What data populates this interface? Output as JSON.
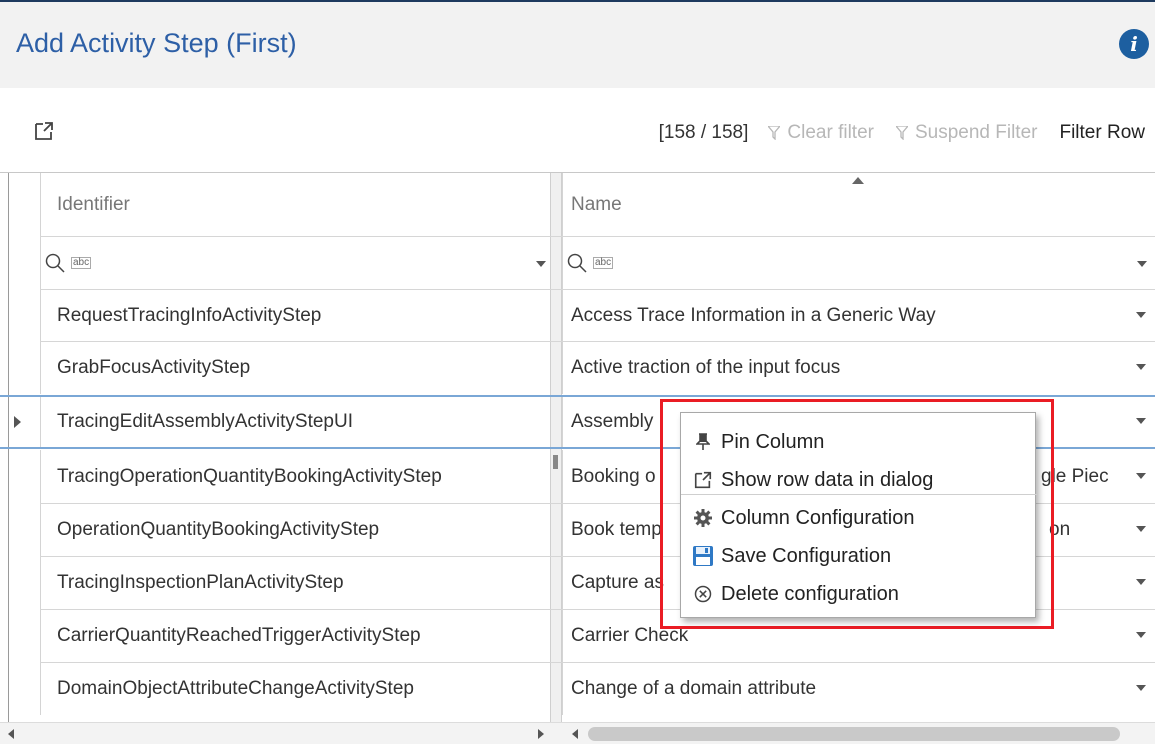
{
  "dialog": {
    "title": "Add Activity Step (First)",
    "info_icon": "info-icon"
  },
  "toolbar": {
    "counter": "[158 / 158]",
    "clear_filter": "Clear filter",
    "suspend_filter": "Suspend Filter",
    "filter_row": "Filter Row"
  },
  "columns": {
    "identifier": "Identifier",
    "name": "Name"
  },
  "rows": [
    {
      "identifier": "RequestTracingInfoActivityStep",
      "name": "Access Trace Information in a Generic Way"
    },
    {
      "identifier": "GrabFocusActivityStep",
      "name": "Active traction of the input focus"
    },
    {
      "identifier": "TracingEditAssemblyActivityStepUI",
      "name": "Assembly"
    },
    {
      "identifier": "TracingOperationQuantityBookingActivityStep",
      "name": "Booking o",
      "name_tail": "gle Piec"
    },
    {
      "identifier": "OperationQuantityBookingActivityStep",
      "name": "Book temp",
      "name_tail": "on"
    },
    {
      "identifier": "TracingInspectionPlanActivityStep",
      "name": "Capture as"
    },
    {
      "identifier": "CarrierQuantityReachedTriggerActivityStep",
      "name": "Carrier Check"
    },
    {
      "identifier": "DomainObjectAttributeChangeActivityStep",
      "name": "Change of a domain attribute"
    }
  ],
  "context_menu": {
    "items": [
      {
        "label": "Pin Column",
        "icon": "pin-icon"
      },
      {
        "label": "Show row data in dialog",
        "icon": "popout-icon"
      },
      {
        "label": "Column Configuration",
        "icon": "gear-icon"
      },
      {
        "label": "Save Configuration",
        "icon": "save-icon"
      },
      {
        "label": "Delete configuration",
        "icon": "delete-circle-icon"
      }
    ]
  },
  "colors": {
    "title": "#2d5fa6",
    "highlight": "#ea1c24",
    "selection": "#7aa7d6",
    "info": "#1d5fa0"
  }
}
